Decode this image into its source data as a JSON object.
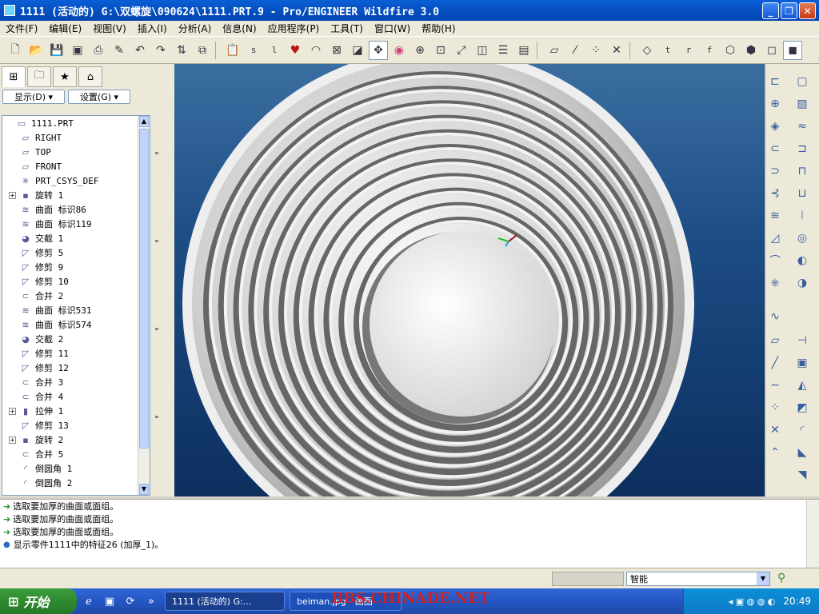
{
  "window": {
    "title": "1111 (活动的) G:\\双螺旋\\090624\\1111.PRT.9 - Pro/ENGINEER Wildfire 3.0",
    "icon": "proe-window-icon"
  },
  "menu": {
    "items": [
      {
        "label": "文件(F)"
      },
      {
        "label": "编辑(E)"
      },
      {
        "label": "视图(V)"
      },
      {
        "label": "插入(I)"
      },
      {
        "label": "分析(A)"
      },
      {
        "label": "信息(N)"
      },
      {
        "label": "应用程序(P)"
      },
      {
        "label": "工具(T)"
      },
      {
        "label": "窗口(W)"
      },
      {
        "label": "帮助(H)"
      }
    ]
  },
  "toolbar": {
    "view_letters": [
      "s",
      "l"
    ],
    "datum_letters": [
      "t",
      "r",
      "f"
    ]
  },
  "left_panel": {
    "show_button": "显示(D) ▾",
    "settings_button": "设置(G) ▾"
  },
  "tree": {
    "items": [
      {
        "label": "1111.PRT",
        "icon": "part-icon",
        "level": 0,
        "expand": false
      },
      {
        "label": "RIGHT",
        "icon": "datum-plane-icon",
        "level": 1,
        "expand": false
      },
      {
        "label": "TOP",
        "icon": "datum-plane-icon",
        "level": 1,
        "expand": false
      },
      {
        "label": "FRONT",
        "icon": "datum-plane-icon",
        "level": 1,
        "expand": false
      },
      {
        "label": "PRT_CSYS_DEF",
        "icon": "csys-icon",
        "level": 1,
        "expand": false
      },
      {
        "label": "旋转 1",
        "icon": "revolve-icon",
        "level": 1,
        "expand": true
      },
      {
        "label": "曲面 标识86",
        "icon": "surface-icon",
        "level": 1,
        "expand": false
      },
      {
        "label": "曲面 标识119",
        "icon": "surface-icon",
        "level": 1,
        "expand": false
      },
      {
        "label": "交截 1",
        "icon": "intersect-icon",
        "level": 1,
        "expand": false
      },
      {
        "label": "修剪 5",
        "icon": "trim-icon",
        "level": 1,
        "expand": false
      },
      {
        "label": "修剪 9",
        "icon": "trim-icon",
        "level": 1,
        "expand": false
      },
      {
        "label": "修剪 10",
        "icon": "trim-icon",
        "level": 1,
        "expand": false
      },
      {
        "label": "合并 2",
        "icon": "merge-icon",
        "level": 1,
        "expand": false
      },
      {
        "label": "曲面 标识531",
        "icon": "surface-icon",
        "level": 1,
        "expand": false
      },
      {
        "label": "曲面 标识574",
        "icon": "surface-icon",
        "level": 1,
        "expand": false
      },
      {
        "label": "交截 2",
        "icon": "intersect-icon",
        "level": 1,
        "expand": false
      },
      {
        "label": "修剪 11",
        "icon": "trim-icon",
        "level": 1,
        "expand": false
      },
      {
        "label": "修剪 12",
        "icon": "trim-icon",
        "level": 1,
        "expand": false
      },
      {
        "label": "合并 3",
        "icon": "merge-icon",
        "level": 1,
        "expand": false
      },
      {
        "label": "合并 4",
        "icon": "merge-icon",
        "level": 1,
        "expand": false
      },
      {
        "label": "拉伸 1",
        "icon": "extrude-icon",
        "level": 1,
        "expand": true
      },
      {
        "label": "修剪 13",
        "icon": "trim-icon",
        "level": 1,
        "expand": false
      },
      {
        "label": "旋转 2",
        "icon": "revolve-icon",
        "level": 1,
        "expand": true
      },
      {
        "label": "合并 5",
        "icon": "merge-icon",
        "level": 1,
        "expand": false
      },
      {
        "label": "倒圆角 1",
        "icon": "round-icon",
        "level": 1,
        "expand": false
      },
      {
        "label": "倒圆角 2",
        "icon": "round-icon",
        "level": 1,
        "expand": false
      }
    ]
  },
  "messages": [
    {
      "type": "prompt",
      "text": "选取要加厚的曲面或面组。"
    },
    {
      "type": "prompt",
      "text": "选取要加厚的曲面或面组。"
    },
    {
      "type": "prompt",
      "text": "选取要加厚的曲面或面组。"
    },
    {
      "type": "info",
      "text": "显示零件1111中的特征26 (加厚_1)。"
    }
  ],
  "status": {
    "filter_value": "智能"
  },
  "taskbar": {
    "start_label": "开始",
    "tasks": [
      {
        "label": "1111 (活动的) G:..."
      },
      {
        "label": "beiman.jpg - 画图"
      }
    ],
    "clock": "20:49",
    "watermark": "BBS.CHINADE.NET"
  },
  "colors": {
    "viewport_top": "#3a6ea0",
    "viewport_bottom": "#0c2f5e",
    "model_light": "#f4f4f4",
    "model_dark": "#7a7a7a"
  }
}
